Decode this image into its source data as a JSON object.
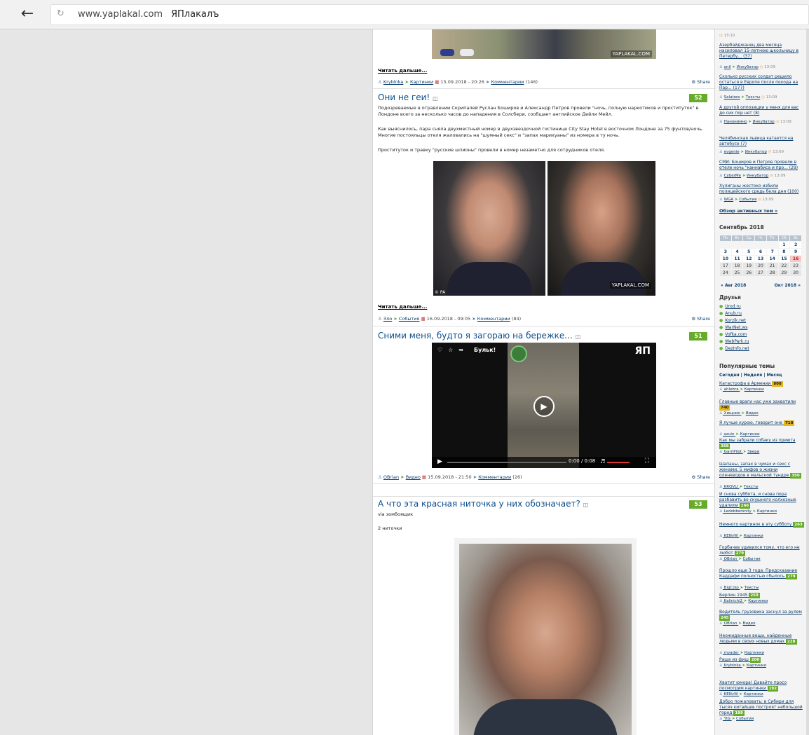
{
  "browser": {
    "url": "www.yaplakal.com",
    "page_title": "ЯПлакалъ"
  },
  "posts": [
    {
      "read_more": "Читать дальше...",
      "author": "Kryblnka",
      "category": "Картинки",
      "date": "15.09.2018 - 20:26",
      "comments_label": "Комментарии",
      "comments_count": "(146)",
      "share": "Share",
      "watermark": "YAPLAKAL.COM"
    },
    {
      "title": "Они не геи!",
      "rating": "52",
      "paragraphs": [
        "Подозреваемые в отравлении Скрипалей Руслан Боширов и Александр Петров провели \"ночь, полную наркотиков и проституток\" в Лондоне всего за несколько часов до нападения в Солсбери, сообщает английское Дейли Мейл.",
        "Как выяснилось, пара сняла двухместный номер в двухзвездочной гостинице City Stay Hotel в восточном Лондоне за 75 фунтов/ночь. Многие постояльцы отеля жаловались на \"шумный секс\" и \"запах марихуаны\" из номера в ту ночь.",
        "Проституток и травку \"русские шпионы\" провели в номер незаметно для сотрудников отеля."
      ],
      "photo_caption": "© PA",
      "watermark": "YAPLAKAL.COM",
      "read_more": "Читать дальше...",
      "author": "Зло",
      "category": "События",
      "date": "16.09.2018 - 09:05",
      "comments_label": "Комментарии",
      "comments_count": "(84)",
      "share": "Share"
    },
    {
      "title": "Сними меня, будто я загораю на бережке...",
      "rating": "51",
      "video_title": "Бульк!",
      "video_time": "0:00 / 0:08",
      "video_logo": "ЯП",
      "author": "OBrian",
      "category": "Видео",
      "date": "15.09.2018 - 21:50",
      "comments_label": "Комментарии",
      "comments_count": "(26)",
      "share": "Share"
    },
    {
      "title": "А что эта красная ниточка у них обозначает?",
      "rating": "53",
      "via": "via зомбоящик",
      "subtitle": "2 ниточки"
    }
  ],
  "sidebar": {
    "top_time": "13:10",
    "news": [
      {
        "title": "Азербайджанец два месяца насиловал 15-летнюю школьницу в Петербу...",
        "count": "(37)",
        "author": "onil",
        "category": "Инкубатор",
        "time": "13:09"
      },
      {
        "title": "Сколько русских солдат решило остаться в Европе после похода на Пар...",
        "count": "(177)",
        "author": "Salatore",
        "category": "Тексты",
        "time": "13:09"
      },
      {
        "title": "А другой оппозиции у меня для вас до сих пор нет",
        "count": "(8)",
        "author": "Нанонимно",
        "category": "Инкубатор",
        "time": "13:09"
      },
      {
        "title": "Челябинская львица катается на автобусе",
        "count": "(7)",
        "author": "evgenie",
        "category": "Инкубатор",
        "time": "13:09"
      },
      {
        "title": "СМИ: Боширов и Петров провели в отеле ночь \"каннабиса и про...",
        "count": "(29)",
        "author": "CyberMe",
        "category": "Инкубатор",
        "time": "13:09"
      },
      {
        "title": "Хулиганы жестоко избили полицейского средь бела дня",
        "count": "(100)",
        "author": "WGA",
        "category": "События",
        "time": "13:09"
      }
    ],
    "active_topics": "Обзор активных тем »",
    "calendar": {
      "title": "Сентябрь 2018",
      "days": [
        "Пн",
        "Вт",
        "Ср",
        "Чт",
        "Пт",
        "Сб",
        "Вс"
      ],
      "weeks": [
        [
          "",
          "",
          "",
          "",
          "",
          "1",
          "2"
        ],
        [
          "3",
          "4",
          "5",
          "6",
          "7",
          "8",
          "9"
        ],
        [
          "10",
          "11",
          "12",
          "13",
          "14",
          "15",
          "16"
        ],
        [
          "17",
          "18",
          "19",
          "20",
          "21",
          "22",
          "23"
        ],
        [
          "24",
          "25",
          "26",
          "27",
          "28",
          "29",
          "30"
        ]
      ],
      "prev": "« Авг 2018",
      "next": "Окт 2018 »"
    },
    "friends_heading": "Друзья",
    "friends": [
      "Urod.ru",
      "Anub.ru",
      "Korzik.net",
      "WarNet.ws",
      "Vofka.com",
      "WebPark.ru",
      "DezInfo.net"
    ],
    "popular_heading": "Популярные темы",
    "popular_tabs": "Сегодня | Неделя | Месяц",
    "popular": [
      {
        "title": "Катастрофа в Армении",
        "score": "808",
        "gold": true,
        "author": "ahlebra",
        "category": "Картинки"
      },
      {
        "title": "Главные враги нас уже захватили",
        "score": "740",
        "gold": true,
        "author": "Хищник",
        "category": "Видео"
      },
      {
        "title": "Я лучше курою, говорит оне",
        "score": "718",
        "gold": true,
        "author": "azuin",
        "category": "Картинки"
      },
      {
        "title": "Как мы забрали собаку из приюта",
        "score": "368",
        "gold": false,
        "author": "GarriPilot",
        "category": "Звери"
      },
      {
        "title": "Шапаны, запах в чумах и секс с женами. 5 мифов о жизни оленеводов в мальской тундре",
        "score": "350",
        "gold": false,
        "author": "KROVLI",
        "category": "Тексты"
      },
      {
        "title": "И снова суббота, и снова пора разбавить во скушного колхозные удалили",
        "score": "266",
        "gold": false,
        "author": "Ledobbersnity",
        "category": "Картинки"
      },
      {
        "title": "Немного картинок в эту субботу",
        "score": "263",
        "gold": false,
        "author": "KENvW",
        "category": "Картинки"
      },
      {
        "title": "Горбачев удивился тому, что его не любят",
        "score": "279",
        "gold": false,
        "author": "OBrian",
        "category": "События"
      },
      {
        "title": "Прошло еще 3 года. Предсказание Каддафи полностью сбылось",
        "score": "279",
        "gold": false,
        "author": "BigCoip",
        "category": "Тексты"
      },
      {
        "title": "Берлин 1945",
        "score": "259",
        "gold": false,
        "author": "Kalinichi2",
        "category": "Картинки"
      },
      {
        "title": "Водитель грузовика заснул за рулем",
        "score": "245",
        "gold": false,
        "author": "OBrian",
        "category": "Видео"
      },
      {
        "title": "Неожиданные вещи, найденные людьми в своих новых домах",
        "score": "228",
        "gold": false,
        "author": "mvader",
        "category": "Картинки"
      },
      {
        "title": "Раша из фиш",
        "score": "200",
        "gold": false,
        "author": "Kryblnka",
        "category": "Картинки"
      },
      {
        "title": "Хватит юмора! Давайте просо посмотрим картинки",
        "score": "192",
        "gold": false,
        "author": "KENvW",
        "category": "Картинки"
      },
      {
        "title": "Добро пожаловать: в Сибири для тысяч китайцев построят небольшой город",
        "score": "188",
        "gold": false,
        "author": "YIG",
        "category": "События"
      }
    ]
  }
}
